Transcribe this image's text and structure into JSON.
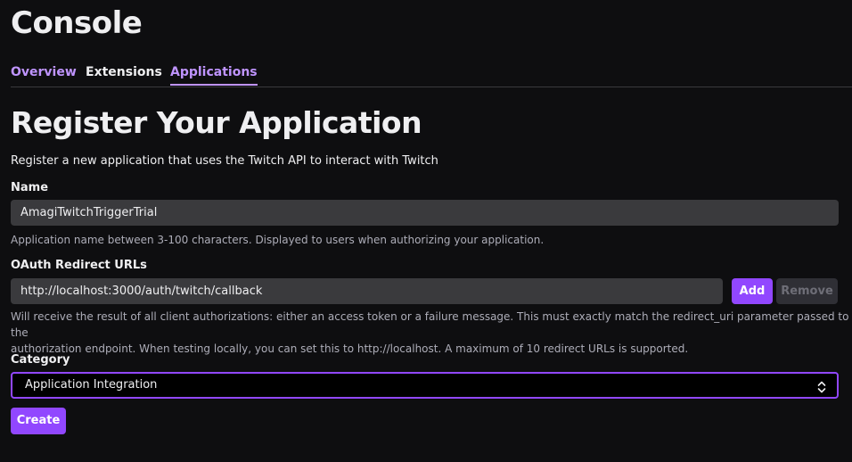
{
  "header": {
    "title": "Console"
  },
  "tabs": [
    {
      "label": "Overview"
    },
    {
      "label": "Extensions"
    },
    {
      "label": "Applications"
    }
  ],
  "form": {
    "heading": "Register Your Application",
    "subtitle": "Register a new application that uses the Twitch API to interact with Twitch",
    "name": {
      "label": "Name",
      "value": "AmagiTwitchTriggerTrial",
      "help": "Application name between 3-100 characters. Displayed to users when authorizing your application."
    },
    "oauth": {
      "label": "OAuth Redirect URLs",
      "value": "http://localhost:3000/auth/twitch/callback",
      "add_label": "Add",
      "remove_label": "Remove",
      "help_line1": "Will receive the result of all client authorizations: either an access token or a failure message. This must exactly match the redirect_uri parameter passed to the",
      "help_line2": "authorization endpoint. When testing locally, you can set this to http://localhost. A maximum of 10 redirect URLs is supported."
    },
    "category": {
      "label": "Category",
      "selected": "Application Integration"
    },
    "create_label": "Create"
  },
  "colors": {
    "accent": "#9147ff",
    "accent_text": "#bf94ff",
    "background": "#0e0e10",
    "input_bg": "#3a3a3d"
  },
  "icons": {
    "select_arrow": "chevron-up-down-icon"
  }
}
